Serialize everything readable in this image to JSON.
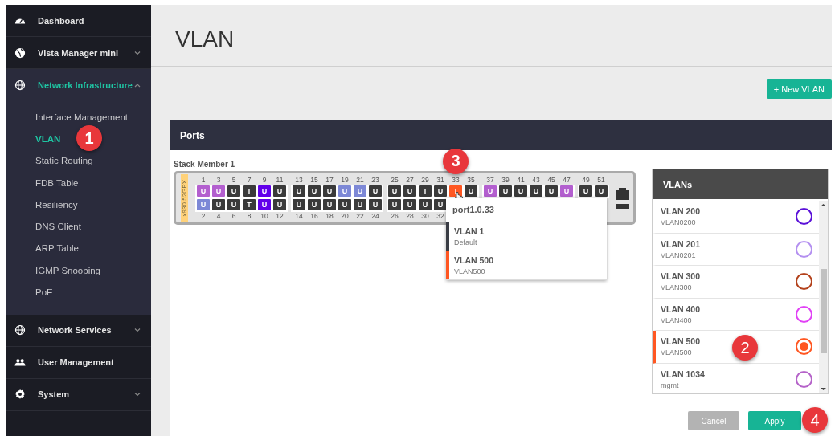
{
  "sidebar": {
    "items": [
      {
        "label": "Dashboard",
        "kind": "gauge"
      },
      {
        "label": "Vista Manager mini",
        "kind": "globe",
        "expanded": false
      },
      {
        "label": "Network Infrastructure",
        "kind": "network",
        "expanded": true,
        "children": [
          {
            "label": "Interface Management",
            "selected": false
          },
          {
            "label": "VLAN",
            "selected": true,
            "callout": "1"
          },
          {
            "label": "Static Routing",
            "selected": false
          },
          {
            "label": "FDB Table",
            "selected": false
          },
          {
            "label": "Resiliency",
            "selected": false
          },
          {
            "label": "DNS Client",
            "selected": false
          },
          {
            "label": "ARP Table",
            "selected": false
          },
          {
            "label": "IGMP Snooping",
            "selected": false
          },
          {
            "label": "PoE",
            "selected": false
          }
        ]
      },
      {
        "label": "Network Services",
        "kind": "network",
        "expanded": false
      },
      {
        "label": "User Management",
        "kind": "users"
      },
      {
        "label": "System",
        "kind": "gear",
        "expanded": false
      }
    ]
  },
  "page": {
    "title": "VLAN",
    "new_button": "+ New VLAN"
  },
  "ports_card": {
    "title": "Ports",
    "stack_member": "Stack Member 1",
    "model_label": "x930 52GPX",
    "groups": [
      [
        {
          "top": {
            "number": "1",
            "mode": "U",
            "color": "#b35fcf",
            "hovered": false
          },
          "bottom": {
            "number": "2",
            "mode": "U",
            "color": "#7d88d6",
            "hovered": false
          }
        },
        {
          "top": {
            "number": "3",
            "mode": "U",
            "color": "#b35fcf",
            "hovered": false
          },
          "bottom": {
            "number": "4",
            "mode": "U",
            "color": "#3a3a3a",
            "hovered": false
          }
        },
        {
          "top": {
            "number": "5",
            "mode": "U",
            "color": "#3a3a3a",
            "hovered": false
          },
          "bottom": {
            "number": "6",
            "mode": "U",
            "color": "#3a3a3a",
            "hovered": false
          }
        },
        {
          "top": {
            "number": "7",
            "mode": "T",
            "color": "#3a3a3a",
            "hovered": false
          },
          "bottom": {
            "number": "8",
            "mode": "T",
            "color": "#3a3a3a",
            "hovered": false
          }
        },
        {
          "top": {
            "number": "9",
            "mode": "U",
            "color": "#6200ea",
            "hovered": false
          },
          "bottom": {
            "number": "10",
            "mode": "U",
            "color": "#6200ea",
            "hovered": false
          }
        },
        {
          "top": {
            "number": "11",
            "mode": "U",
            "color": "#3a3a3a",
            "hovered": false
          },
          "bottom": {
            "number": "12",
            "mode": "U",
            "color": "#3a3a3a",
            "hovered": false
          }
        }
      ],
      [
        {
          "top": {
            "number": "13",
            "mode": "U",
            "color": "#3a3a3a",
            "hovered": false
          },
          "bottom": {
            "number": "14",
            "mode": "U",
            "color": "#3a3a3a",
            "hovered": false
          }
        },
        {
          "top": {
            "number": "15",
            "mode": "U",
            "color": "#3a3a3a",
            "hovered": false
          },
          "bottom": {
            "number": "16",
            "mode": "U",
            "color": "#3a3a3a",
            "hovered": false
          }
        },
        {
          "top": {
            "number": "17",
            "mode": "U",
            "color": "#3a3a3a",
            "hovered": false
          },
          "bottom": {
            "number": "18",
            "mode": "U",
            "color": "#3a3a3a",
            "hovered": false
          }
        },
        {
          "top": {
            "number": "19",
            "mode": "U",
            "color": "#7d88d6",
            "hovered": false
          },
          "bottom": {
            "number": "20",
            "mode": "U",
            "color": "#3a3a3a",
            "hovered": false
          }
        },
        {
          "top": {
            "number": "21",
            "mode": "U",
            "color": "#7d88d6",
            "hovered": false
          },
          "bottom": {
            "number": "22",
            "mode": "U",
            "color": "#3a3a3a",
            "hovered": false
          }
        },
        {
          "top": {
            "number": "23",
            "mode": "U",
            "color": "#3a3a3a",
            "hovered": false
          },
          "bottom": {
            "number": "24",
            "mode": "U",
            "color": "#3a3a3a",
            "hovered": false
          }
        }
      ],
      [
        {
          "top": {
            "number": "25",
            "mode": "U",
            "color": "#3a3a3a",
            "hovered": false
          },
          "bottom": {
            "number": "26",
            "mode": "U",
            "color": "#3a3a3a",
            "hovered": false
          }
        },
        {
          "top": {
            "number": "27",
            "mode": "U",
            "color": "#3a3a3a",
            "hovered": false
          },
          "bottom": {
            "number": "28",
            "mode": "U",
            "color": "#3a3a3a",
            "hovered": false
          }
        },
        {
          "top": {
            "number": "29",
            "mode": "T",
            "color": "#3a3a3a",
            "hovered": false
          },
          "bottom": {
            "number": "30",
            "mode": "U",
            "color": "#3a3a3a",
            "hovered": false
          }
        },
        {
          "top": {
            "number": "31",
            "mode": "U",
            "color": "#3a3a3a",
            "hovered": false
          },
          "bottom": {
            "number": "32",
            "mode": "U",
            "color": "#3a3a3a",
            "hovered": false
          }
        },
        {
          "top": {
            "number": "33",
            "mode": "T",
            "color": "#ff5722",
            "hovered": true,
            "callout": "3"
          }
        },
        {
          "top": {
            "number": "35",
            "mode": "U",
            "color": "#3a3a3a",
            "hovered": false
          }
        }
      ],
      [
        {
          "top": {
            "number": "37",
            "mode": "U",
            "color": "#b35fcf",
            "hovered": false
          }
        },
        {
          "top": {
            "number": "39",
            "mode": "U",
            "color": "#3a3a3a",
            "hovered": false
          }
        },
        {
          "top": {
            "number": "41",
            "mode": "U",
            "color": "#3a3a3a",
            "hovered": false
          }
        },
        {
          "top": {
            "number": "43",
            "mode": "U",
            "color": "#3a3a3a",
            "hovered": false
          }
        },
        {
          "top": {
            "number": "45",
            "mode": "U",
            "color": "#3a3a3a",
            "hovered": false
          }
        },
        {
          "top": {
            "number": "47",
            "mode": "U",
            "color": "#b35fcf",
            "hovered": false
          }
        }
      ],
      [
        {
          "top": {
            "number": "49",
            "mode": "U",
            "color": "#3a3a3a",
            "hovered": false
          }
        },
        {
          "top": {
            "number": "51",
            "mode": "U",
            "color": "#3a3a3a",
            "hovered": false
          }
        }
      ]
    ],
    "tooltip": {
      "title": "port1.0.33",
      "entries": [
        {
          "name": "VLAN 1",
          "description": "Default",
          "color": "#3a3d45"
        },
        {
          "name": "VLAN 500",
          "description": "VLAN500",
          "color": "#ff5722"
        }
      ]
    },
    "vlans": {
      "title": "VLANs",
      "items": [
        {
          "name": "VLAN 200",
          "description": "VLAN0200",
          "color": "#5b12d8",
          "selected": false
        },
        {
          "name": "VLAN 201",
          "description": "VLAN0201",
          "color": "#b490f0",
          "selected": false
        },
        {
          "name": "VLAN 300",
          "description": "VLAN300",
          "color": "#b3421c",
          "selected": false
        },
        {
          "name": "VLAN 400",
          "description": "VLAN400",
          "color": "#e142f5",
          "selected": false
        },
        {
          "name": "VLAN 500",
          "description": "VLAN500",
          "color": "#ff5722",
          "selected": true,
          "callout": "2"
        },
        {
          "name": "VLAN 1034",
          "description": "mgmt",
          "color": "#b563c9",
          "selected": false
        }
      ]
    },
    "buttons": [
      {
        "label": "Cancel",
        "kind": "secondary"
      },
      {
        "label": "Apply",
        "kind": "primary",
        "callout": "4"
      }
    ]
  }
}
